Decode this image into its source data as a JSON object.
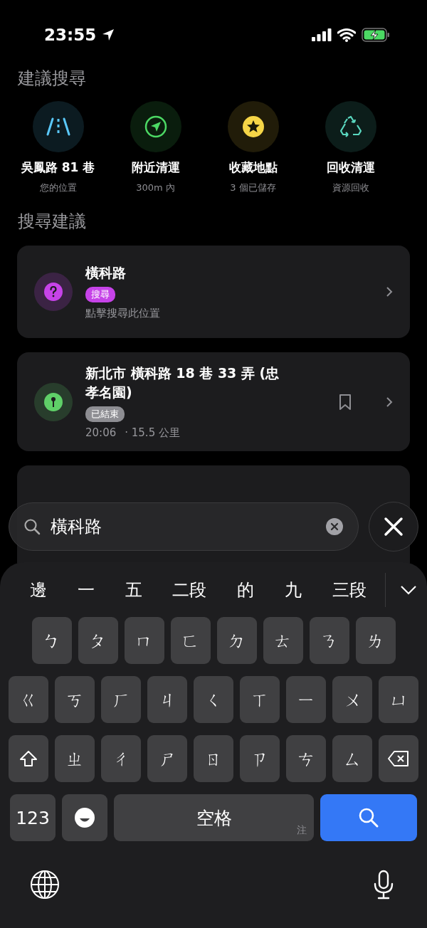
{
  "status_bar": {
    "time": "23:55"
  },
  "suggested": {
    "title": "建議搜尋",
    "items": [
      {
        "kind": "road",
        "label": "吳鳳路 81 巷",
        "sub": "您的位置",
        "color": "#5ac8fa"
      },
      {
        "kind": "nav",
        "label": "附近清運",
        "sub": "300m 內",
        "color": "#4cd964"
      },
      {
        "kind": "star",
        "label": "收藏地點",
        "sub": "3 個已儲存",
        "color": "#f5d547"
      },
      {
        "kind": "recycle",
        "label": "回收清運",
        "sub": "資源回收",
        "color": "#5ad8c0"
      }
    ]
  },
  "results": {
    "title": "搜尋建議",
    "items": [
      {
        "kind": "question",
        "title": "橫科路",
        "badge": {
          "text": "搜尋",
          "color": "#c643e8"
        },
        "detail": "點擊搜尋此位置",
        "bookmark": false,
        "color": "#c643e8"
      },
      {
        "kind": "pin",
        "title": "新北市 橫科路 18 巷 33 弄 (忠孝名園)",
        "badge": {
          "text": "已結束",
          "color": "#8e8e93"
        },
        "time": "20:06",
        "distance": "· 15.5 公里",
        "bookmark": true,
        "color": "#5fd068"
      }
    ]
  },
  "search": {
    "value": "橫科路"
  },
  "keyboard": {
    "candidates": [
      "邊",
      "一",
      "五",
      "二段",
      "的",
      "九",
      "三段"
    ],
    "rows": [
      [
        "ㄅ",
        "ㄆ",
        "ㄇ",
        "ㄈ",
        "ㄉ",
        "ㄊ",
        "ㄋ",
        "ㄌ"
      ],
      [
        "ㄍ",
        "ㄎ",
        "ㄏ",
        "ㄐ",
        "ㄑ",
        "ㄒ",
        "ㄧ",
        "ㄨ",
        "ㄩ"
      ],
      [
        "ㄓ",
        "ㄔ",
        "ㄕ",
        "ㄖ",
        "ㄗ",
        "ㄘ",
        "ㄙ"
      ]
    ],
    "number_key": "123",
    "space": "空格",
    "space_hint": "注"
  }
}
